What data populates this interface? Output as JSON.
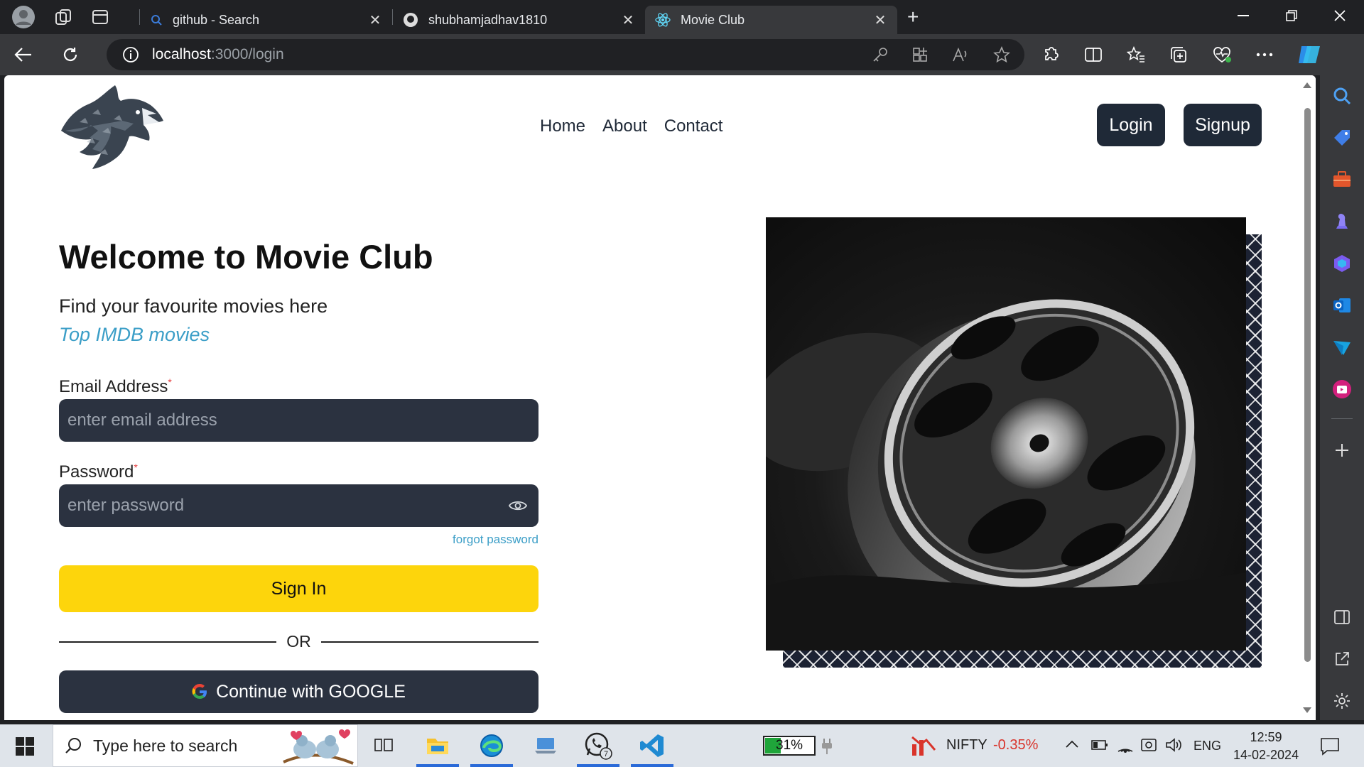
{
  "browser": {
    "tabs": [
      {
        "title": "github - Search",
        "active": false
      },
      {
        "title": "shubhamjadhav1810",
        "active": false
      },
      {
        "title": "Movie Club",
        "active": true
      }
    ],
    "url_host": "localhost",
    "url_path": ":3000/login"
  },
  "nav": {
    "links": [
      "Home",
      "About",
      "Contact"
    ],
    "login": "Login",
    "signup": "Signup"
  },
  "hero": {
    "title": "Welcome to Movie Club",
    "subtitle": "Find your favourite movies here",
    "tagline": "Top IMDB movies"
  },
  "form": {
    "email_label": "Email Address",
    "email_required": "*",
    "email_placeholder": "enter email address",
    "password_label": "Password",
    "password_required": "*",
    "password_placeholder": "enter password",
    "forgot": "forgot password",
    "signin": "Sign In",
    "or": "OR",
    "google": "Continue with GOOGLE"
  },
  "taskbar": {
    "search_placeholder": "Type here to search",
    "battery": "31%",
    "whatsapp_badge": "7",
    "ticker_name": "NIFTY",
    "ticker_change": "-0.35%",
    "lang": "ENG",
    "time": "12:59",
    "date": "14-02-2024"
  },
  "colors": {
    "accent_yellow": "#fdd50c",
    "dark": "#1f2937",
    "link": "#3b9ec7",
    "ticker_neg": "#d9342b"
  }
}
